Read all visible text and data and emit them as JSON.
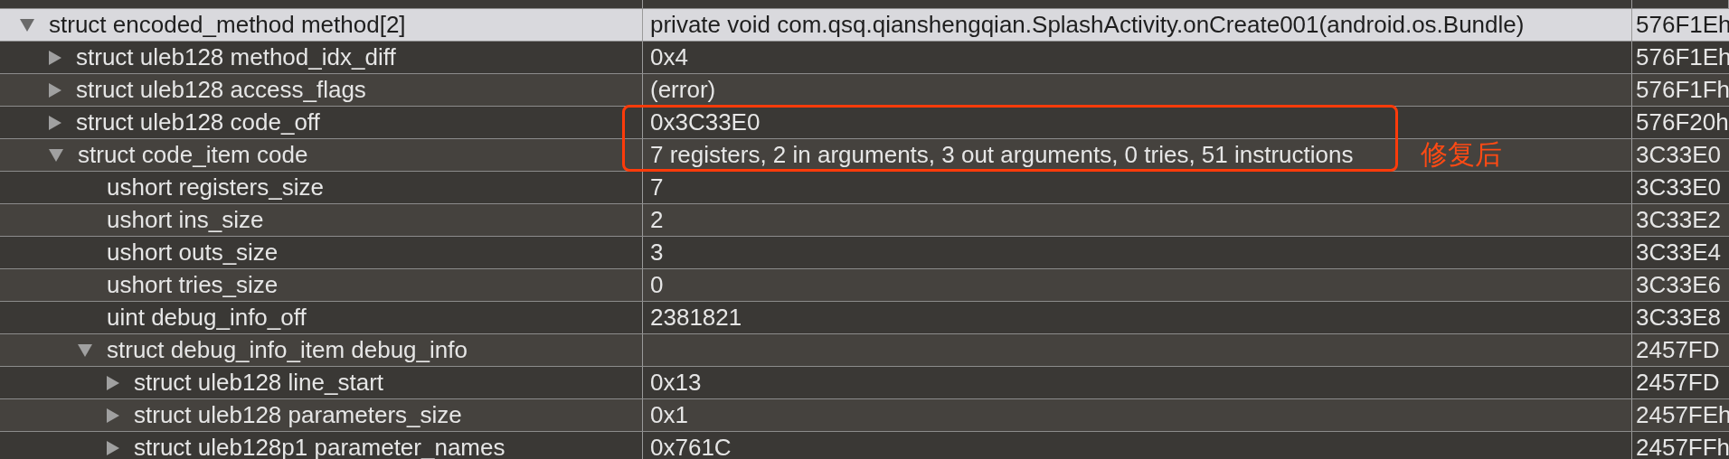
{
  "tree": [
    {
      "name": "struct encoded_method method[2]",
      "value": "private void com.qsq.qianshengqian.SplashActivity.onCreate001(android.os.Bundle)",
      "start": "576F1Eh",
      "expanded": true,
      "selected": true,
      "children": [
        {
          "name": "struct uleb128 method_idx_diff",
          "value": "0x4",
          "start": "576F1Eh",
          "expanded": false,
          "selected": false
        },
        {
          "name": "struct uleb128 access_flags",
          "value": "(error)",
          "start": "576F1Fh",
          "expanded": false,
          "selected": false
        },
        {
          "name": "struct uleb128 code_off",
          "value": "0x3C33E0",
          "start": "576F20h",
          "expanded": false,
          "selected": false
        },
        {
          "name": "struct code_item code",
          "value": "7 registers, 2 in arguments, 3 out arguments, 0 tries, 51 instructions",
          "start": "3C33E0",
          "expanded": true,
          "selected": false,
          "annotation": "修复后",
          "children": [
            {
              "name": "ushort registers_size",
              "value": "7",
              "start": "3C33E0",
              "selected": false
            },
            {
              "name": "ushort ins_size",
              "value": "2",
              "start": "3C33E2",
              "selected": false
            },
            {
              "name": "ushort outs_size",
              "value": "3",
              "start": "3C33E4",
              "selected": false
            },
            {
              "name": "ushort tries_size",
              "value": "0",
              "start": "3C33E6",
              "selected": false
            },
            {
              "name": "uint debug_info_off",
              "value": "2381821",
              "start": "3C33E8",
              "selected": false
            },
            {
              "name": "struct debug_info_item debug_info",
              "start": "2457FD",
              "expanded": true,
              "selected": false,
              "children": [
                {
                  "name": "struct uleb128 line_start",
                  "value": "0x13",
                  "start": "2457FD",
                  "expanded": false,
                  "selected": false
                },
                {
                  "name": "struct uleb128 parameters_size",
                  "value": "0x1",
                  "start": "2457FEh",
                  "expanded": false,
                  "selected": false
                },
                {
                  "name": "struct uleb128p1 parameter_names",
                  "value": "0x761C",
                  "start": "2457FFh",
                  "expanded": false,
                  "selected": false
                }
              ]
            }
          ]
        }
      ]
    }
  ]
}
